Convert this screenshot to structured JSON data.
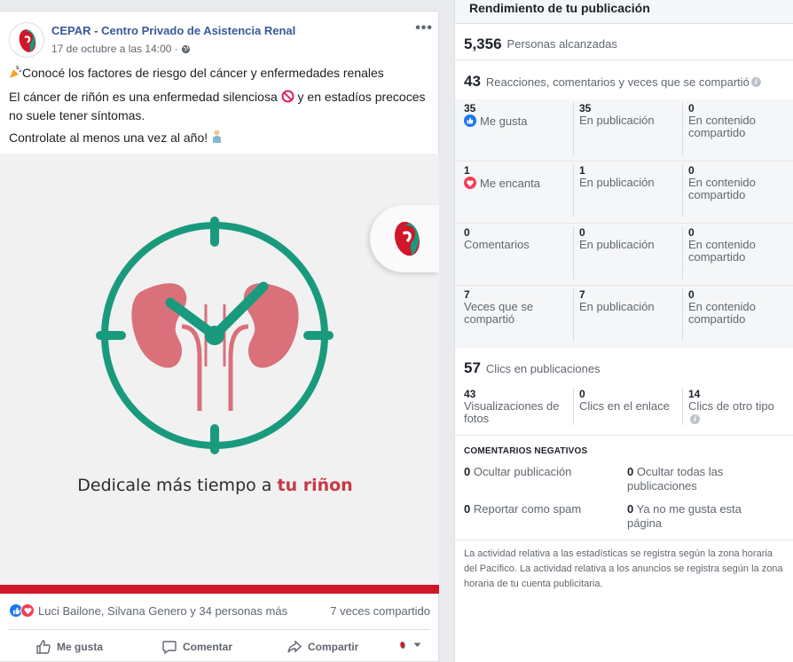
{
  "post": {
    "page_name": "CEPAR - Centro Privado de Asistencia Renal",
    "date": "17 de octubre a las 14:00 ·",
    "more_label": "•••",
    "text_line1": "Conocé los factores de riesgo del cáncer y enfermedades renales",
    "text_line2a": "El cáncer de riñón es una enfermedad silenciosa",
    "text_line2b": "y en estadíos precoces no suele tener síntomas.",
    "text_line3": "Controlate al menos una vez al año!",
    "image_caption_a": "Dedicale más tiempo a",
    "image_caption_b": "tu riñon",
    "reactors": "Luci Bailone, Silvana Genero y 34 personas más",
    "shares": "7 veces compartido",
    "actions": {
      "like": "Me gusta",
      "comment": "Comentar",
      "share": "Compartir"
    }
  },
  "panel": {
    "title": "Rendimiento de tu publicación",
    "reach": {
      "value": "5,356",
      "label": "Personas alcanzadas"
    },
    "engagement": {
      "value": "43",
      "label": "Reacciones, comentarios y veces que se compartió"
    },
    "rows": [
      {
        "total": "35",
        "label": "Me gusta",
        "on_post": "35",
        "on_post_label": "En publicación",
        "on_shared": "0",
        "on_shared_label": "En contenido compartido"
      },
      {
        "total": "1",
        "label": "Me encanta",
        "on_post": "1",
        "on_post_label": "En publicación",
        "on_shared": "0",
        "on_shared_label": "En contenido compartido"
      },
      {
        "total": "0",
        "label": "Comentarios",
        "on_post": "0",
        "on_post_label": "En publicación",
        "on_shared": "0",
        "on_shared_label": "En contenido compartido"
      },
      {
        "total": "7",
        "label": "Veces que se compartió",
        "on_post": "7",
        "on_post_label": "En publicación",
        "on_shared": "0",
        "on_shared_label": "En contenido compartido"
      }
    ],
    "clicks": {
      "value": "57",
      "label": "Clics en publicaciones",
      "photo_views": "43",
      "photo_views_label": "Visualizaciones de fotos",
      "link_clicks": "0",
      "link_clicks_label": "Clics en el enlace",
      "other_clicks": "14",
      "other_clicks_label": "Clics de otro tipo"
    },
    "negative": {
      "title": "COMENTARIOS NEGATIVOS",
      "hide_post": "0",
      "hide_post_label": "Ocultar publicación",
      "hide_all": "0",
      "hide_all_label": "Ocultar todas las publicaciones",
      "spam": "0",
      "spam_label": "Reportar como spam",
      "unlike": "0",
      "unlike_label": "Ya no me gusta esta página"
    },
    "footer": "La actividad relativa a las estadísticas se registra según la zona horaria del Pacífico. La actividad relativa a los anuncios se registra según la zona horaria de tu cuenta publicitaria."
  },
  "colors": {
    "link": "#385898",
    "accent": "#1877f2",
    "love": "#f33e58",
    "clock": "#199a7d",
    "kidney": "#d9707a",
    "brand_red": "#d0172a"
  },
  "icons": [
    "globe-icon",
    "party-popper-icon",
    "no-entry-icon",
    "person-icon",
    "like-icon",
    "love-icon",
    "comment-icon",
    "share-icon",
    "info-icon"
  ]
}
